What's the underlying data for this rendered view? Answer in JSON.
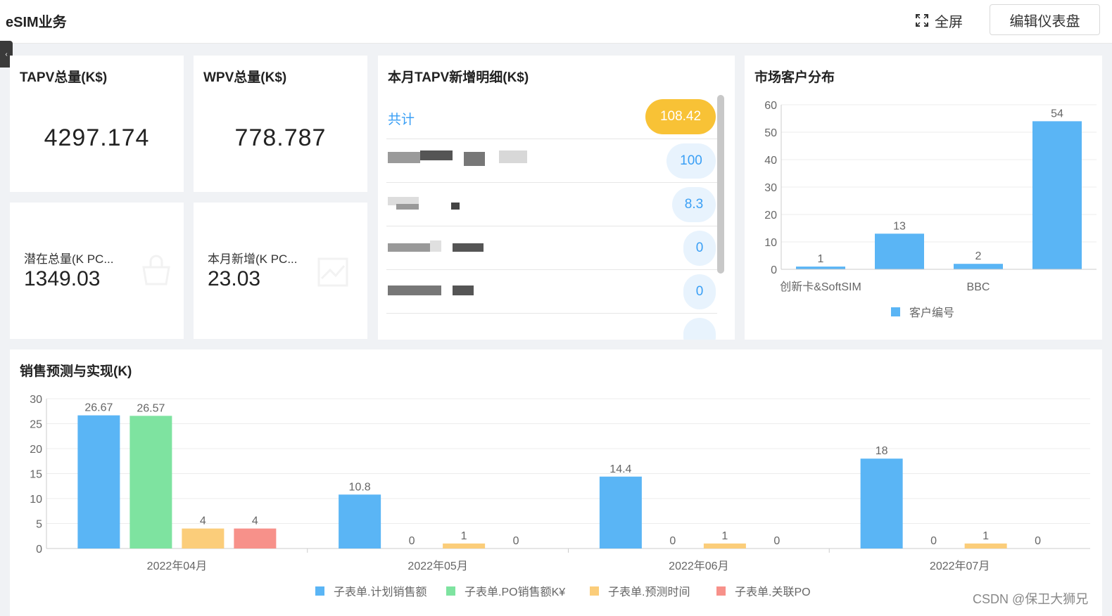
{
  "header": {
    "title": "eSIM业务",
    "fullscreen_label": "全屏",
    "edit_label": "编辑仪表盘"
  },
  "kpis": {
    "tapv": {
      "title": "TAPV总量(K$)",
      "value": "4297.174"
    },
    "wpv": {
      "title": "WPV总量(K$)",
      "value": "778.787"
    },
    "potential": {
      "label": "潜在总量(K PC...",
      "value": "1349.03"
    },
    "monthly_new": {
      "label": "本月新增(K PC...",
      "value": "23.03"
    }
  },
  "tapv_detail": {
    "title": "本月TAPV新增明细(K$)",
    "total_label": "共计",
    "total_value": "108.42",
    "rows": [
      {
        "value": "100"
      },
      {
        "value": "8.3"
      },
      {
        "value": "0"
      },
      {
        "value": "0"
      }
    ]
  },
  "market": {
    "title": "市场客户分布",
    "legend_label": "客户编号"
  },
  "sales": {
    "title": "销售预测与实现(K)"
  },
  "colors": {
    "blue": "#5ab5f5",
    "green": "#7ee3a0",
    "orange": "#fbcd7a",
    "red": "#f7918a",
    "accent": "#3a9ff5",
    "pill_yellow": "#f8c236"
  },
  "chart_data": [
    {
      "type": "bar",
      "title": "市场客户分布",
      "categories": [
        "创新卡&SoftSIM",
        "",
        "BBC",
        ""
      ],
      "series": [
        {
          "name": "客户编号",
          "values": [
            1,
            13,
            2,
            54
          ]
        }
      ],
      "ylim": [
        0,
        60
      ],
      "yticks": [
        0,
        10,
        20,
        30,
        40,
        50,
        60
      ],
      "legend": "bottom-center",
      "grid": true
    },
    {
      "type": "bar",
      "title": "销售预测与实现(K)",
      "categories": [
        "2022年04月",
        "2022年05月",
        "2022年06月",
        "2022年07月"
      ],
      "series": [
        {
          "name": "子表单.计划销售额",
          "values": [
            26.67,
            10.8,
            14.4,
            18
          ]
        },
        {
          "name": "子表单.PO销售额K¥",
          "values": [
            26.57,
            0,
            0,
            0
          ]
        },
        {
          "name": "子表单.预测时间",
          "values": [
            4,
            1,
            1,
            1
          ]
        },
        {
          "name": "子表单.关联PO",
          "values": [
            4,
            0,
            0,
            0
          ]
        }
      ],
      "ylim": [
        0,
        30
      ],
      "yticks": [
        0,
        5,
        10,
        15,
        20,
        25,
        30
      ],
      "legend": "bottom-center",
      "grid": true
    }
  ],
  "watermark": "CSDN @保卫大狮兄"
}
